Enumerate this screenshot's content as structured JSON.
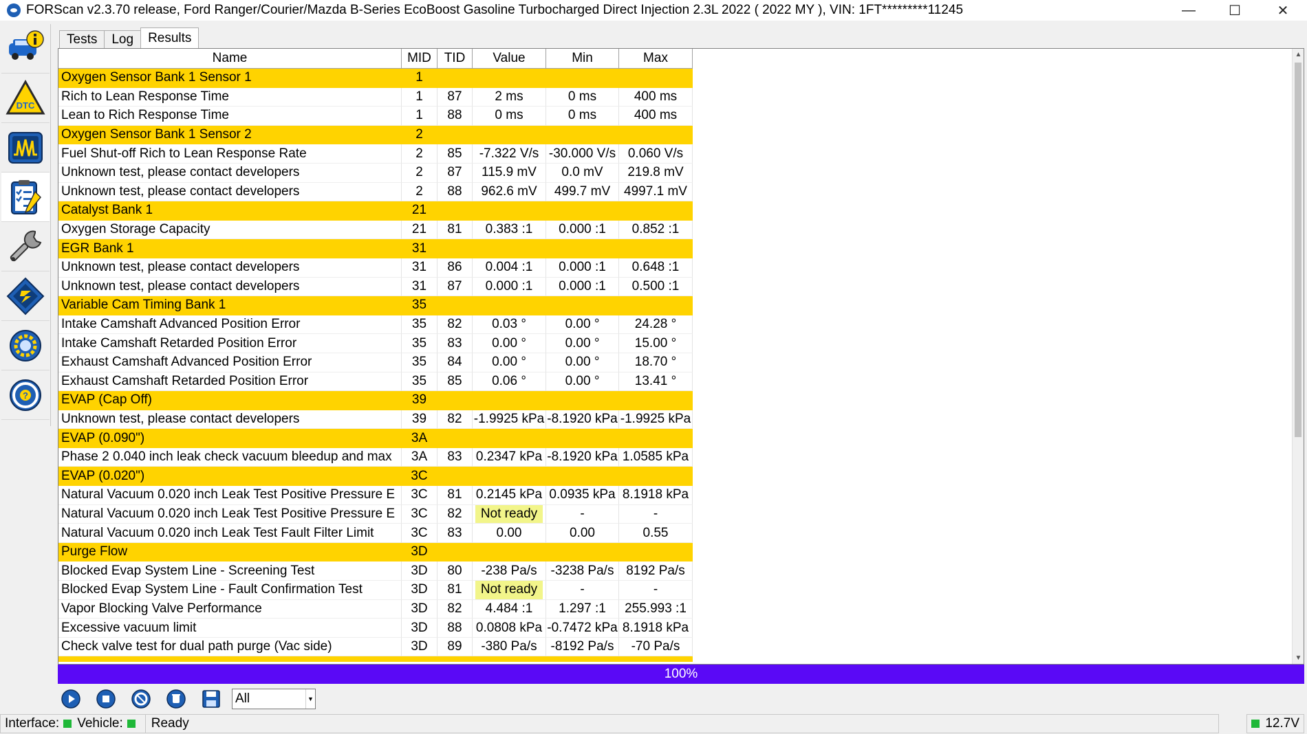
{
  "window": {
    "title": "FORScan v2.3.70 release, Ford Ranger/Courier/Mazda B-Series EcoBoost Gasoline Turbocharged Direct Injection 2.3L 2022 ( 2022 MY ), VIN: 1FT*********11245",
    "minimize": "—",
    "maximize": "☐",
    "close": "✕"
  },
  "sidebar": {
    "items": [
      {
        "icon": "vehicle-info-icon"
      },
      {
        "icon": "dtc-icon"
      },
      {
        "icon": "oscilloscope-icon"
      },
      {
        "icon": "tests-checklist-icon",
        "active": true
      },
      {
        "icon": "service-wrench-icon"
      },
      {
        "icon": "configuration-chip-icon"
      },
      {
        "icon": "settings-gear-icon"
      },
      {
        "icon": "help-steering-icon"
      }
    ]
  },
  "tabs": [
    {
      "label": "Tests"
    },
    {
      "label": "Log"
    },
    {
      "label": "Results",
      "active": true
    }
  ],
  "table": {
    "headers": {
      "name": "Name",
      "mid": "MID",
      "tid": "TID",
      "value": "Value",
      "min": "Min",
      "max": "Max"
    },
    "rows": [
      {
        "group": true,
        "name": "Oxygen Sensor Bank 1 Sensor 1",
        "mid": "1",
        "tid": "",
        "value": "",
        "min": "",
        "max": ""
      },
      {
        "name": "Rich to Lean Response Time",
        "mid": "1",
        "tid": "87",
        "value": "2 ms",
        "min": "0 ms",
        "max": "400 ms"
      },
      {
        "name": "Lean to Rich Response Time",
        "mid": "1",
        "tid": "88",
        "value": "0 ms",
        "min": "0 ms",
        "max": "400 ms"
      },
      {
        "group": true,
        "name": "Oxygen Sensor Bank 1 Sensor 2",
        "mid": "2",
        "tid": "",
        "value": "",
        "min": "",
        "max": ""
      },
      {
        "name": "Fuel Shut-off Rich to Lean Response Rate",
        "mid": "2",
        "tid": "85",
        "value": "-7.322 V/s",
        "min": "-30.000 V/s",
        "max": "0.060 V/s"
      },
      {
        "name": "Unknown test, please contact developers",
        "mid": "2",
        "tid": "87",
        "value": "115.9 mV",
        "min": "0.0 mV",
        "max": "219.8 mV"
      },
      {
        "name": "Unknown test, please contact developers",
        "mid": "2",
        "tid": "88",
        "value": "962.6 mV",
        "min": "499.7 mV",
        "max": "4997.1 mV"
      },
      {
        "group": true,
        "name": "Catalyst Bank 1",
        "mid": "21",
        "tid": "",
        "value": "",
        "min": "",
        "max": ""
      },
      {
        "name": "Oxygen Storage Capacity",
        "mid": "21",
        "tid": "81",
        "value": "0.383 :1",
        "min": "0.000 :1",
        "max": "0.852 :1"
      },
      {
        "group": true,
        "name": "EGR Bank 1",
        "mid": "31",
        "tid": "",
        "value": "",
        "min": "",
        "max": ""
      },
      {
        "name": "Unknown test, please contact developers",
        "mid": "31",
        "tid": "86",
        "value": "0.004 :1",
        "min": "0.000 :1",
        "max": "0.648 :1"
      },
      {
        "name": "Unknown test, please contact developers",
        "mid": "31",
        "tid": "87",
        "value": "0.000 :1",
        "min": "0.000 :1",
        "max": "0.500 :1"
      },
      {
        "group": true,
        "name": "Variable Cam Timing Bank 1",
        "mid": "35",
        "tid": "",
        "value": "",
        "min": "",
        "max": ""
      },
      {
        "name": "Intake Camshaft Advanced Position Error",
        "mid": "35",
        "tid": "82",
        "value": "0.03 °",
        "min": "0.00 °",
        "max": "24.28 °"
      },
      {
        "name": "Intake Camshaft Retarded Position Error",
        "mid": "35",
        "tid": "83",
        "value": "0.00 °",
        "min": "0.00 °",
        "max": "15.00 °"
      },
      {
        "name": "Exhaust Camshaft Advanced Position Error",
        "mid": "35",
        "tid": "84",
        "value": "0.00 °",
        "min": "0.00 °",
        "max": "18.70 °"
      },
      {
        "name": "Exhaust Camshaft Retarded Position Error",
        "mid": "35",
        "tid": "85",
        "value": "0.06 °",
        "min": "0.00 °",
        "max": "13.41 °"
      },
      {
        "group": true,
        "name": "EVAP (Cap Off)",
        "mid": "39",
        "tid": "",
        "value": "",
        "min": "",
        "max": ""
      },
      {
        "name": "Unknown test, please contact developers",
        "mid": "39",
        "tid": "82",
        "value": "-1.9925 kPa",
        "min": "-8.1920 kPa",
        "max": "-1.9925 kPa"
      },
      {
        "group": true,
        "name": "EVAP (0.090\")",
        "mid": "3A",
        "tid": "",
        "value": "",
        "min": "",
        "max": ""
      },
      {
        "name": "Phase 2 0.040 inch leak check vacuum bleedup and max",
        "mid": "3A",
        "tid": "83",
        "value": "0.2347 kPa",
        "min": "-8.1920 kPa",
        "max": "1.0585 kPa"
      },
      {
        "group": true,
        "name": "EVAP (0.020\")",
        "mid": "3C",
        "tid": "",
        "value": "",
        "min": "",
        "max": ""
      },
      {
        "name": "Natural Vacuum 0.020 inch Leak Test Positive Pressure E",
        "mid": "3C",
        "tid": "81",
        "value": "0.2145 kPa",
        "min": "0.0935 kPa",
        "max": "8.1918 kPa"
      },
      {
        "name": "Natural Vacuum 0.020 inch Leak Test Positive Pressure E",
        "mid": "3C",
        "tid": "82",
        "value": "Not ready",
        "notready": true,
        "min": "-",
        "max": "-"
      },
      {
        "name": "Natural Vacuum 0.020 inch Leak Test Fault Filter Limit",
        "mid": "3C",
        "tid": "83",
        "value": "0.00",
        "min": "0.00",
        "max": "0.55"
      },
      {
        "group": true,
        "name": "Purge Flow",
        "mid": "3D",
        "tid": "",
        "value": "",
        "min": "",
        "max": ""
      },
      {
        "name": "Blocked Evap System Line - Screening Test",
        "mid": "3D",
        "tid": "80",
        "value": "-238 Pa/s",
        "min": "-3238 Pa/s",
        "max": "8192 Pa/s"
      },
      {
        "name": "Blocked Evap System Line - Fault Confirmation Test",
        "mid": "3D",
        "tid": "81",
        "value": "Not ready",
        "notready": true,
        "min": "-",
        "max": "-"
      },
      {
        "name": "Vapor Blocking Valve Performance",
        "mid": "3D",
        "tid": "82",
        "value": "4.484 :1",
        "min": "1.297 :1",
        "max": "255.993 :1"
      },
      {
        "name": "Excessive vacuum limit",
        "mid": "3D",
        "tid": "88",
        "value": "0.0808 kPa",
        "min": "-0.7472 kPa",
        "max": "8.1918 kPa"
      },
      {
        "name": "Check valve test for dual path purge (Vac side)",
        "mid": "3D",
        "tid": "89",
        "value": "-380 Pa/s",
        "min": "-8192 Pa/s",
        "max": "-70 Pa/s"
      }
    ]
  },
  "progress": {
    "label": "100%",
    "fraction": 1.0
  },
  "toolbar": {
    "buttons": [
      "play-icon",
      "stop-icon",
      "help-run-icon",
      "clear-icon",
      "save-icon"
    ],
    "filter_value": "All"
  },
  "status": {
    "interface_label": "Interface:",
    "vehicle_label": "Vehicle:",
    "state": "Ready",
    "voltage": "12.7V"
  },
  "colors": {
    "group_row": "#ffd300",
    "not_ready": "#f2f58a",
    "progress": "#5a09f6",
    "led_green": "#1fb838"
  }
}
